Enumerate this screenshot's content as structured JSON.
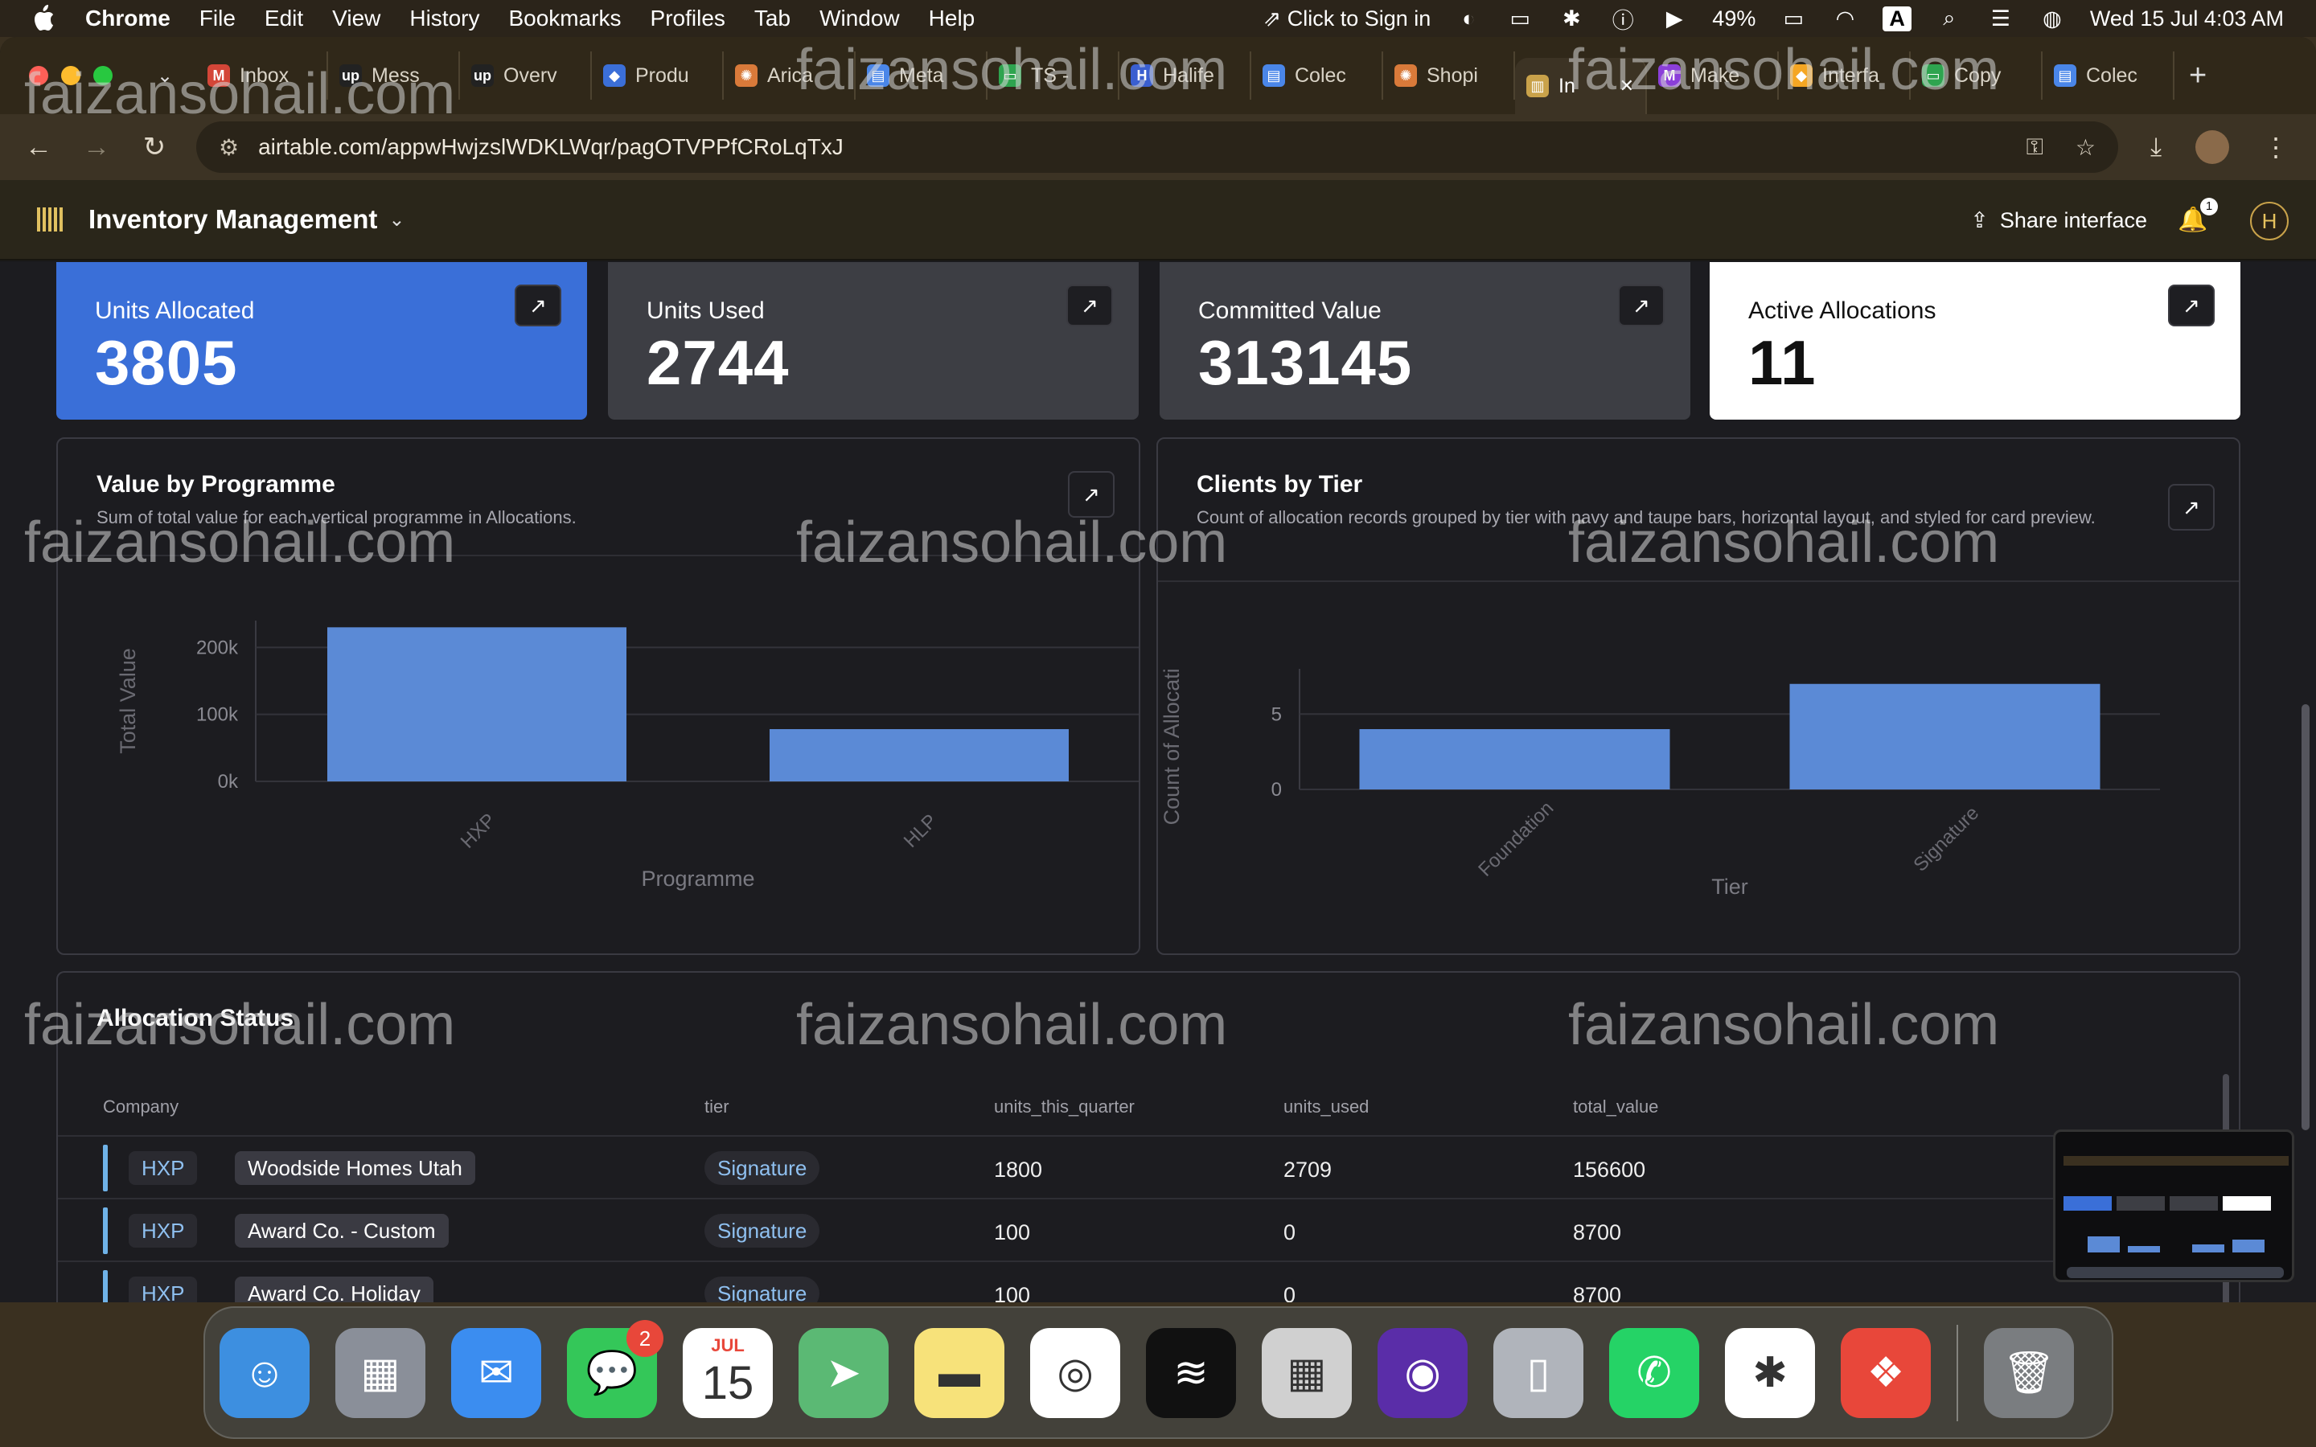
{
  "menubar": {
    "app_name": "Chrome",
    "items": [
      "File",
      "Edit",
      "View",
      "History",
      "Bookmarks",
      "Profiles",
      "Tab",
      "Window",
      "Help"
    ],
    "sign_in": "Click to Sign in",
    "battery": "49%",
    "input_source": "A",
    "datetime": "Wed 15 Jul  4:03 AM"
  },
  "tabs": [
    {
      "label": "Inbox",
      "fav": "M",
      "color": "#d44638"
    },
    {
      "label": "Mess",
      "fav": "up",
      "color": "#222"
    },
    {
      "label": "Overv",
      "fav": "up",
      "color": "#222"
    },
    {
      "label": "Produ",
      "fav": "◆",
      "color": "#3b6fd8"
    },
    {
      "label": "Arica",
      "fav": "✺",
      "color": "#d97a3a"
    },
    {
      "label": "Meta",
      "fav": "▤",
      "color": "#4a86e8"
    },
    {
      "label": "TS -",
      "fav": "▭",
      "color": "#2ea44f"
    },
    {
      "label": "Halife",
      "fav": "H",
      "color": "#3a5fd0"
    },
    {
      "label": "Colec",
      "fav": "▤",
      "color": "#4a86e8"
    },
    {
      "label": "Shopi",
      "fav": "✺",
      "color": "#d97a3a"
    },
    {
      "label": "In",
      "fav": "▥",
      "color": "#c9a24a",
      "active": true
    },
    {
      "label": "Make",
      "fav": "M",
      "color": "#8b3fd9"
    },
    {
      "label": "Interfa",
      "fav": "◆",
      "color": "#f5a623"
    },
    {
      "label": "Copy",
      "fav": "▭",
      "color": "#2ea44f"
    },
    {
      "label": "Colec",
      "fav": "▤",
      "color": "#4a86e8"
    }
  ],
  "url": "airtable.com/appwHwjzslWDKLWqr/pagOTVPPfCRoLqTxJ",
  "app": {
    "title": "Inventory Management",
    "share_label": "Share interface",
    "notif_count": "1",
    "avatar_letter": "H"
  },
  "stats": [
    {
      "label": "Units Allocated",
      "value": "3805",
      "bg": "#3a6fd8",
      "fg": "#ffffff"
    },
    {
      "label": "Units Used",
      "value": "2744",
      "bg": "#3d3e44",
      "fg": "#ffffff"
    },
    {
      "label": "Committed Value",
      "value": "313145",
      "bg": "#3d3e44",
      "fg": "#ffffff"
    },
    {
      "label": "Active Allocations",
      "value": "11",
      "bg": "#ffffff",
      "fg": "#111111"
    }
  ],
  "panels": {
    "value_by_programme": {
      "title": "Value by Programme",
      "subtitle": "Sum of total value for each vertical programme in Allocations."
    },
    "clients_by_tier": {
      "title": "Clients by Tier",
      "subtitle": "Count of allocation records grouped by tier with navy and taupe bars, horizontal layout, and styled for card preview."
    }
  },
  "chart_data": [
    {
      "type": "bar",
      "categories": [
        "HXP",
        "HLP"
      ],
      "values": [
        230000,
        78000
      ],
      "xlabel": "Programme",
      "ylabel": "Total Value",
      "yticks": [
        "0k",
        "100k",
        "200k"
      ],
      "ylim": [
        0,
        240000
      ],
      "grid": true,
      "color": "#5b8ad6"
    },
    {
      "type": "bar",
      "categories": [
        "Foundation",
        "Signature"
      ],
      "values": [
        4,
        7
      ],
      "xlabel": "Tier",
      "ylabel": "Count of Allocations",
      "yticks": [
        "0",
        "5"
      ],
      "ylim": [
        0,
        8
      ],
      "grid": true,
      "color": "#5b8ad6"
    }
  ],
  "table": {
    "title": "Allocation Status",
    "headers": [
      "Company",
      "tier",
      "units_this_quarter",
      "units_used",
      "total_value"
    ],
    "rows": [
      {
        "programme": "HXP",
        "company": "Woodside Homes Utah",
        "tier": "Signature",
        "units_this_quarter": "1800",
        "units_used": "2709",
        "total_value": "156600"
      },
      {
        "programme": "HXP",
        "company": "Award Co. - Custom",
        "tier": "Signature",
        "units_this_quarter": "100",
        "units_used": "0",
        "total_value": "8700"
      },
      {
        "programme": "HXP",
        "company": "Award Co. Holiday",
        "tier": "Signature",
        "units_this_quarter": "100",
        "units_used": "0",
        "total_value": "8700"
      }
    ]
  },
  "watermark": "faizansohail.com",
  "dock": [
    {
      "name": "finder",
      "glyph": "☺",
      "bg": "#3d8fe0"
    },
    {
      "name": "launchpad",
      "glyph": "▦",
      "bg": "#8a8f99"
    },
    {
      "name": "mail",
      "glyph": "✉",
      "bg": "#3b8df0"
    },
    {
      "name": "messages",
      "glyph": "💬",
      "bg": "#34c759",
      "badge": "2"
    },
    {
      "name": "calendar",
      "glyph": "15",
      "bg": "#ffffff",
      "month": "JUL"
    },
    {
      "name": "maps",
      "glyph": "➤",
      "bg": "#5bb974"
    },
    {
      "name": "notes",
      "glyph": "▬",
      "bg": "#f7e27a"
    },
    {
      "name": "chrome",
      "glyph": "◎",
      "bg": "#ffffff"
    },
    {
      "name": "spotify",
      "glyph": "≋",
      "bg": "#111111"
    },
    {
      "name": "calculator",
      "glyph": "▦",
      "bg": "#d0d0d0"
    },
    {
      "name": "firefox",
      "glyph": "◉",
      "bg": "#5a2da8"
    },
    {
      "name": "iphone-mirroring",
      "glyph": "▯",
      "bg": "#b0b4bb"
    },
    {
      "name": "whatsapp",
      "glyph": "✆",
      "bg": "#25d366"
    },
    {
      "name": "slack",
      "glyph": "✱",
      "bg": "#ffffff"
    },
    {
      "name": "anydesk",
      "glyph": "❖",
      "bg": "#e8473a"
    },
    {
      "name": "trash",
      "glyph": "🗑",
      "bg": "#7a7d80"
    }
  ]
}
